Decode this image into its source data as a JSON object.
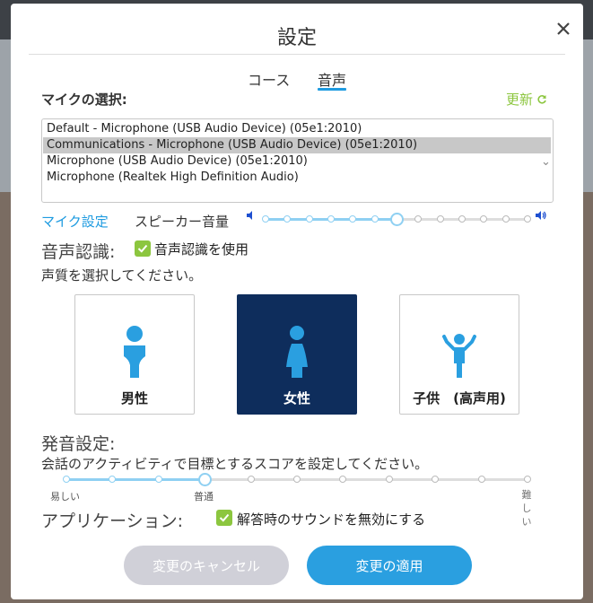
{
  "dialog": {
    "title": "設定"
  },
  "tabs": [
    {
      "label": "コース",
      "active": false
    },
    {
      "label": "音声",
      "active": true
    }
  ],
  "microphone": {
    "label": "マイクの選択:",
    "refresh_label": "更新",
    "options": [
      "Default - Microphone (USB Audio Device) (05e1:2010)",
      "Communications - Microphone (USB Audio Device) (05e1:2010)",
      "Microphone (USB Audio Device) (05e1:2010)",
      "Microphone (Realtek High Definition Audio)"
    ],
    "selected_index": 1
  },
  "speaker": {
    "mic_setup_link": "マイク設定",
    "volume_label": "スピーカー音量",
    "volume_level_fraction": 0.5
  },
  "speech_recognition": {
    "heading": "音声認識:",
    "checkbox_label": "音声認識を使用",
    "checked": true,
    "voice_prompt": "声質を選択してください。",
    "voices": [
      {
        "label": "男性",
        "icon": "male-icon",
        "selected": false
      },
      {
        "label": "女性",
        "icon": "female-icon",
        "selected": true
      },
      {
        "label": "子供　(高声用)",
        "icon": "child-icon",
        "selected": false
      }
    ]
  },
  "pronunciation": {
    "heading": "発音設定:",
    "description": "会話のアクティビティで目標とするスコアを設定してください。",
    "easy_label": "易しい",
    "normal_label": "普通",
    "hard_label": "難しい",
    "level_fraction": 0.3
  },
  "application": {
    "heading": "アプリケーション:",
    "checkbox_label": "解答時のサウンドを無効にする",
    "checked": true
  },
  "buttons": {
    "cancel_label": "変更のキャンセル",
    "apply_label": "変更の適用"
  },
  "colors": {
    "accent": "#1e9be0",
    "check": "#8cc63f",
    "selected_card": "#0e2d5c",
    "icon_blue": "#2a9fe0"
  }
}
